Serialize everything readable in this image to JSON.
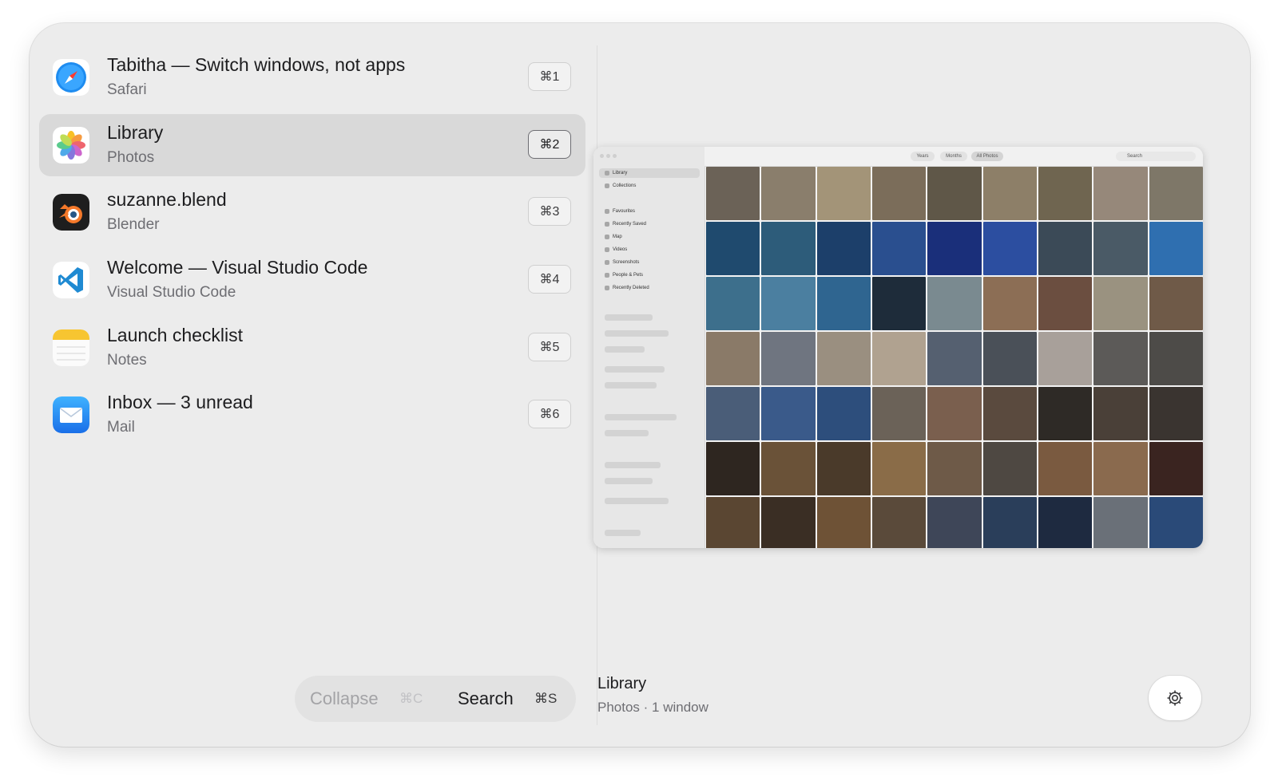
{
  "windows": [
    {
      "title": "Tabitha — Switch windows, not apps",
      "app": "Safari",
      "shortcut": "⌘1",
      "icon": "safari-icon",
      "selected": false
    },
    {
      "title": "Library",
      "app": "Photos",
      "shortcut": "⌘2",
      "icon": "photos-icon",
      "selected": true
    },
    {
      "title": "suzanne.blend",
      "app": "Blender",
      "shortcut": "⌘3",
      "icon": "blender-icon",
      "selected": false
    },
    {
      "title": "Welcome — Visual Studio Code",
      "app": "Visual Studio Code",
      "shortcut": "⌘4",
      "icon": "vscode-icon",
      "selected": false
    },
    {
      "title": "Launch checklist",
      "app": "Notes",
      "shortcut": "⌘5",
      "icon": "notes-icon",
      "selected": false
    },
    {
      "title": "Inbox — 3 unread",
      "app": "Mail",
      "shortcut": "⌘6",
      "icon": "mail-icon",
      "selected": false
    }
  ],
  "toolbar": {
    "collapse_label": "Collapse",
    "collapse_shortcut": "⌘C",
    "search_label": "Search",
    "search_shortcut": "⌘S"
  },
  "preview": {
    "title": "Library",
    "subtitle": "Photos · 1 window",
    "thumbnail": {
      "sidebar_items": [
        "Library",
        "Collections",
        "Favourites",
        "Recently Saved",
        "Map",
        "Videos",
        "Screenshots",
        "People & Pets",
        "Recently Deleted"
      ],
      "toolbar_chips": [
        "Years",
        "Months",
        "All Photos"
      ],
      "search_placeholder": "Search"
    }
  },
  "colors": {
    "panel_bg": "#ececec",
    "selected_row": "#d9d9d9",
    "text_primary": "#1d1d1f",
    "text_secondary": "#6e6e73"
  }
}
